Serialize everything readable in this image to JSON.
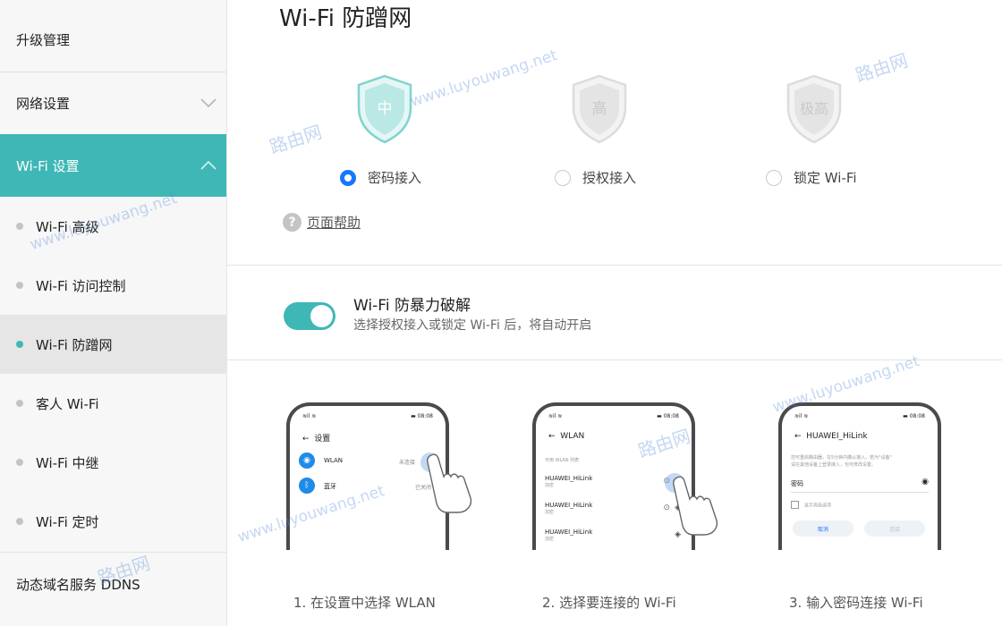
{
  "sidebar": {
    "top_items": [
      {
        "label": "升级管理",
        "expandable": false
      },
      {
        "label": "网络设置",
        "expandable": true,
        "expanded": false
      },
      {
        "label": "Wi-Fi 设置",
        "expandable": true,
        "expanded": true
      }
    ],
    "sub_items": [
      {
        "label": "Wi-Fi 高级",
        "current": false
      },
      {
        "label": "Wi-Fi 访问控制",
        "current": false
      },
      {
        "label": "Wi-Fi 防蹭网",
        "current": true
      },
      {
        "label": "客人 Wi-Fi",
        "current": false
      },
      {
        "label": "Wi-Fi 中继",
        "current": false
      },
      {
        "label": "Wi-Fi 定时",
        "current": false
      }
    ],
    "bottom_item": {
      "label": "动态域名服务 DDNS"
    }
  },
  "main": {
    "title": "Wi-Fi 防蹭网",
    "levels": [
      {
        "shield_text": "中",
        "radio_label": "密码接入",
        "selected": true
      },
      {
        "shield_text": "高",
        "radio_label": "授权接入",
        "selected": false
      },
      {
        "shield_text": "极高",
        "radio_label": "锁定 Wi-Fi",
        "selected": false
      }
    ],
    "help_label": "页面帮助",
    "brute_force": {
      "title": "Wi-Fi 防暴力破解",
      "description": "选择授权接入或锁定 Wi-Fi 后，将自动开启",
      "enabled": true
    },
    "steps": [
      {
        "caption": "1. 在设置中选择 WLAN",
        "screen": {
          "status_left": "≋il ≋",
          "status_right": "▬ 08:08",
          "header": "设置",
          "rows": [
            {
              "icon": "wifi-icon",
              "label": "WLAN",
              "value": "未连接"
            },
            {
              "icon": "bluetooth-icon",
              "label": "蓝牙",
              "value": "已关闭"
            }
          ]
        }
      },
      {
        "caption": "2. 选择要连接的 Wi-Fi",
        "screen": {
          "status_left": "≋il ≋",
          "status_right": "▬ 08:08",
          "header": "WLAN",
          "section": "可用 WLAN 列表",
          "networks": [
            {
              "name": "HUAWEI_HiLink",
              "sub": "加密"
            },
            {
              "name": "HUAWEI_HiLink",
              "sub": "加密"
            },
            {
              "name": "HUAWEI_HiLink",
              "sub": "加密"
            }
          ]
        }
      },
      {
        "caption": "3. 输入密码连接 Wi-Fi",
        "screen": {
          "status_left": "≋il ≋",
          "status_right": "▬ 08:08",
          "header": "HUAWEI_HiLink",
          "note": "您可重启路由器，在5分钟内确认接入，若为\"设备\"\n请在其他设备上登录接入，也可修改设置。",
          "password_label": "密码",
          "checkbox_label": "显示高级选项",
          "cancel_label": "取消",
          "connect_label": "连接"
        }
      }
    ]
  },
  "watermark": {
    "url": "www.luyouwang.net",
    "brand": "路由网"
  },
  "colors": {
    "accent": "#3fb7b6",
    "radio_selected": "#1677ff",
    "active_shield": "#7fd3cf",
    "inactive_shield": "#d9d9d9"
  }
}
